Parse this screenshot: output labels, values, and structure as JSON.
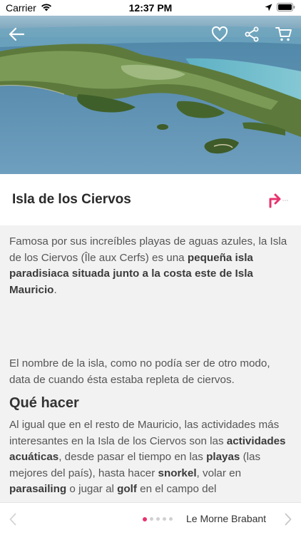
{
  "status_bar": {
    "carrier": "Carrier",
    "time": "12:37 PM"
  },
  "header": {
    "back_icon": "arrow-left-icon",
    "favorite_icon": "heart-icon",
    "share_icon": "share-icon",
    "cart_icon": "cart-icon"
  },
  "place": {
    "title": "Isla de los Ciervos",
    "directions_icon": "directions-arrow-icon"
  },
  "content": {
    "p1_a": "Famosa por sus increíbles playas de aguas azules, la Isla de los Ciervos (Île aux Cerfs) es una ",
    "p1_b": "pequeña isla paradisiaca situada junto a la costa este de Isla Mauricio",
    "p1_c": ".",
    "p2": "El nombre de la isla, como no podía ser de otro modo, data de cuando ésta estaba repleta de ciervos.",
    "section_title": "Qué hacer",
    "p3_a": "Al igual que en el resto de Mauricio, las actividades más interesantes en la Isla de los Ciervos son las ",
    "p3_b": "actividades acuáticas",
    "p3_c": ", desde pasar el tiempo en las ",
    "p3_d": "playas",
    "p3_e": " (las mejores del país), hasta hacer ",
    "p3_f": "snorkel",
    "p3_g": ", volar en ",
    "p3_h": "parasailing",
    "p3_i": " o jugar al ",
    "p3_j": "golf",
    "p3_k": " en el campo del"
  },
  "bottom_nav": {
    "next_label": "Le Morne Brabant",
    "page_index": 1,
    "page_count": 5
  },
  "colors": {
    "accent": "#e8336d",
    "text": "#555555",
    "background": "#f2f2f2"
  }
}
